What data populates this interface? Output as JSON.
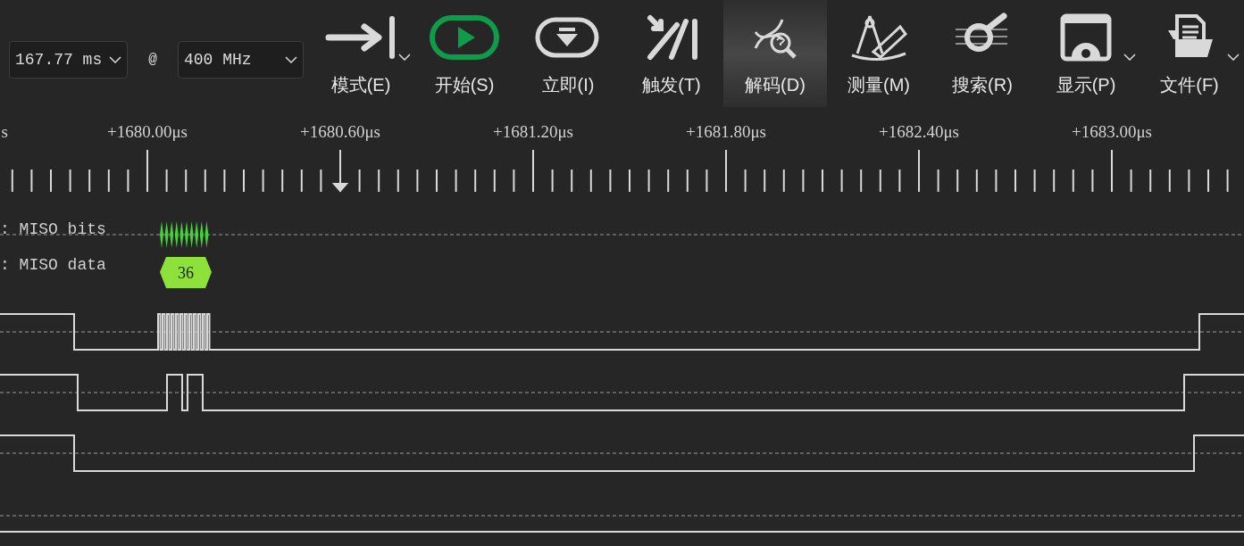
{
  "toolbar": {
    "duration": {
      "value": "167.77 ms"
    },
    "at_sign": "@",
    "sample_rate": {
      "value": "400 MHz"
    },
    "buttons": [
      {
        "label": "模式(E)",
        "kind": "mode",
        "has_menu": true,
        "selected": false
      },
      {
        "label": "开始(S)",
        "kind": "start",
        "has_menu": false,
        "selected": false
      },
      {
        "label": "立即(I)",
        "kind": "instant",
        "has_menu": false,
        "selected": false
      },
      {
        "label": "触发(T)",
        "kind": "trigger",
        "has_menu": false,
        "selected": false
      },
      {
        "label": "解码(D)",
        "kind": "decode",
        "has_menu": false,
        "selected": true
      },
      {
        "label": "测量(M)",
        "kind": "measure",
        "has_menu": false,
        "selected": false
      },
      {
        "label": "搜索(R)",
        "kind": "search",
        "has_menu": false,
        "selected": false
      },
      {
        "label": "显示(P)",
        "kind": "display",
        "has_menu": true,
        "selected": false
      },
      {
        "label": "文件(F)",
        "kind": "file",
        "has_menu": true,
        "selected": false
      }
    ]
  },
  "ruler": {
    "labels": [
      "s",
      "+1680.00μs",
      "+1680.60μs",
      "+1681.20μs",
      "+1681.80μs",
      "+1682.40μs",
      "+1683.00μs"
    ]
  },
  "decoder_rows": [
    {
      "label": ": MISO bits",
      "kind": "bits"
    },
    {
      "label": ": MISO data",
      "kind": "data",
      "value": "36"
    }
  ]
}
